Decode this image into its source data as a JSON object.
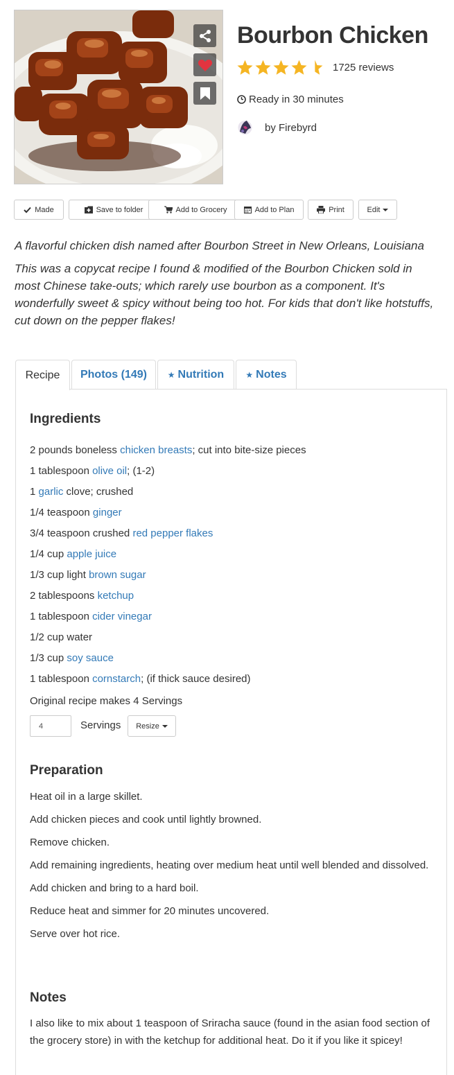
{
  "recipe": {
    "title": "Bourbon Chicken",
    "rating": 4.5,
    "reviews": "1725 reviews",
    "ready": "Ready in 30 minutes",
    "author": "by Firebyrd",
    "summary": "A flavorful chicken dish named after Bourbon Street in New Orleans, Louisiana",
    "description": "This was a copycat recipe I found & modified of the Bourbon Chicken sold in most Chinese take-outs; which rarely use bourbon as a component. It's wonderfully sweet & spicy without being too hot. For kids that don't like hotstuffs, cut down on the pepper flakes!"
  },
  "photo_actions": {
    "share_icon": "share-icon",
    "favorite_icon": "heart-icon",
    "bookmark_icon": "bookmark-icon"
  },
  "toolbar": {
    "made": "Made",
    "save_to_folder": "Save to folder",
    "add_to_grocery": "Add to Grocery",
    "add_to_plan": "Add to Plan",
    "print": "Print",
    "edit": "Edit"
  },
  "tabs": {
    "recipe": "Recipe",
    "photos": "Photos (149)",
    "nutrition": "Nutrition",
    "notes": "Notes"
  },
  "ingredients": {
    "heading": "Ingredients",
    "items": [
      {
        "pre": "2 pounds boneless ",
        "link": "chicken breasts",
        "post": "; cut into bite-size pieces"
      },
      {
        "pre": "1 tablespoon ",
        "link": "olive oil",
        "post": "; (1-2)"
      },
      {
        "pre": "1 ",
        "link": "garlic",
        "post": " clove; crushed"
      },
      {
        "pre": "1/4 teaspoon ",
        "link": "ginger",
        "post": ""
      },
      {
        "pre": "3/4 teaspoon crushed ",
        "link": "red pepper flakes",
        "post": ""
      },
      {
        "pre": "1/4 cup ",
        "link": "apple juice",
        "post": ""
      },
      {
        "pre": "1/3 cup light ",
        "link": "brown sugar",
        "post": ""
      },
      {
        "pre": "2 tablespoons ",
        "link": "ketchup",
        "post": ""
      },
      {
        "pre": "1 tablespoon ",
        "link": "cider vinegar",
        "post": ""
      },
      {
        "pre": "1/2 cup water",
        "link": "",
        "post": ""
      },
      {
        "pre": "1/3 cup ",
        "link": "soy sauce",
        "post": ""
      },
      {
        "pre": "1 tablespoon ",
        "link": "cornstarch",
        "post": "; (if thick sauce desired)"
      }
    ],
    "makes": "Original recipe makes 4 Servings",
    "servings_value": "4",
    "servings_label": "Servings",
    "resize": "Resize"
  },
  "preparation": {
    "heading": "Preparation",
    "steps": [
      "Heat oil in a large skillet.",
      "Add chicken pieces and cook until lightly browned.",
      "Remove chicken.",
      "Add remaining ingredients, heating over medium heat until well blended and dissolved.",
      "Add chicken and bring to a hard boil.",
      "Reduce heat and simmer for 20 minutes uncovered.",
      "Serve over hot rice."
    ]
  },
  "notes": {
    "heading": "Notes",
    "text": "I also like to mix about 1 teaspoon of Sriracha sauce (found in the asian food section of the grocery store) in with the ketchup for additional heat. Do it if you like it spicey!"
  },
  "colors": {
    "link": "#337ab7",
    "star": "#f5b523",
    "heart": "#e2343f"
  }
}
